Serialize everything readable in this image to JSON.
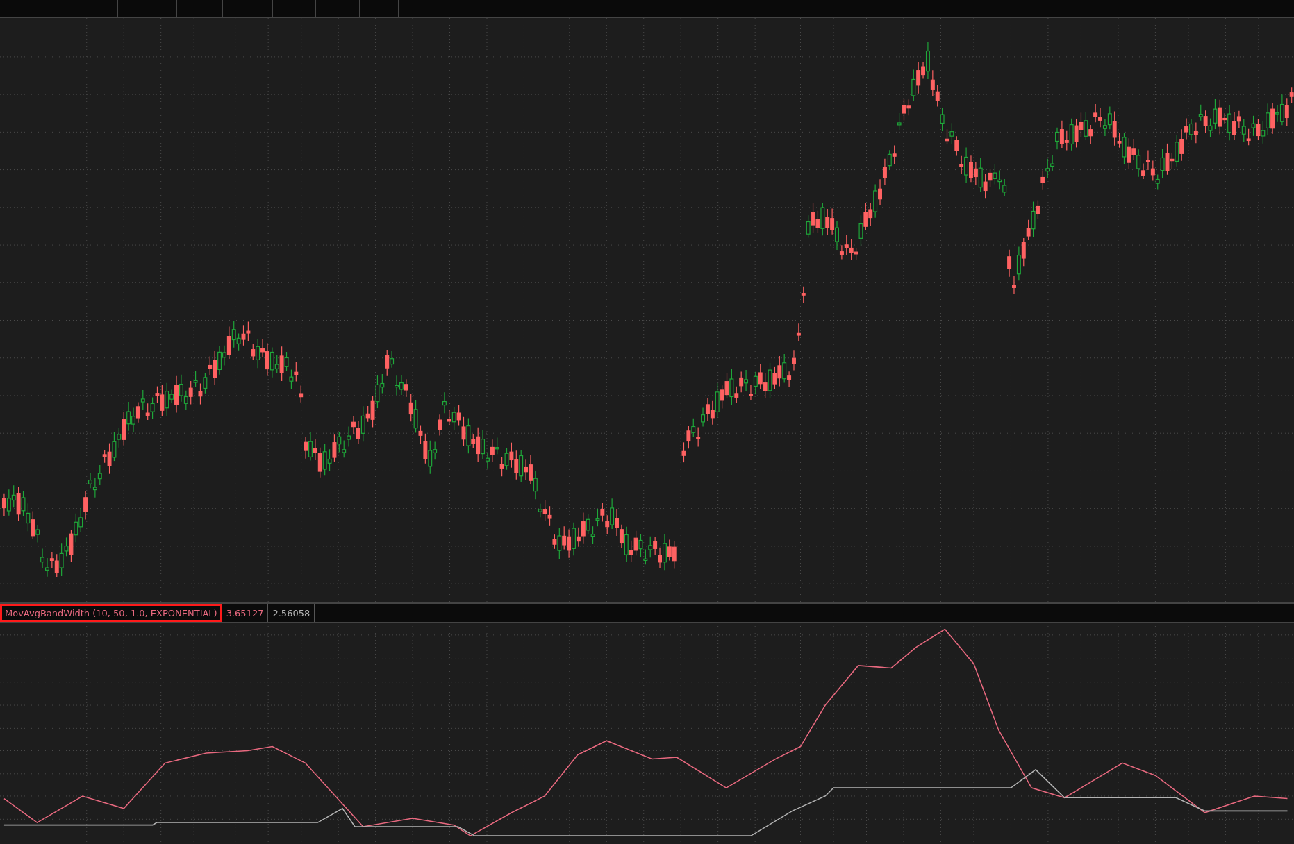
{
  "study": {
    "label": "MovAvgBandWidth (10, 50, 1.0, EXPONENTIAL)",
    "selected": true
  },
  "readings": [
    {
      "value": "3.65127",
      "color": "#e8697f"
    },
    {
      "value": "2.56058",
      "color": "#b4b4b4"
    }
  ]
}
